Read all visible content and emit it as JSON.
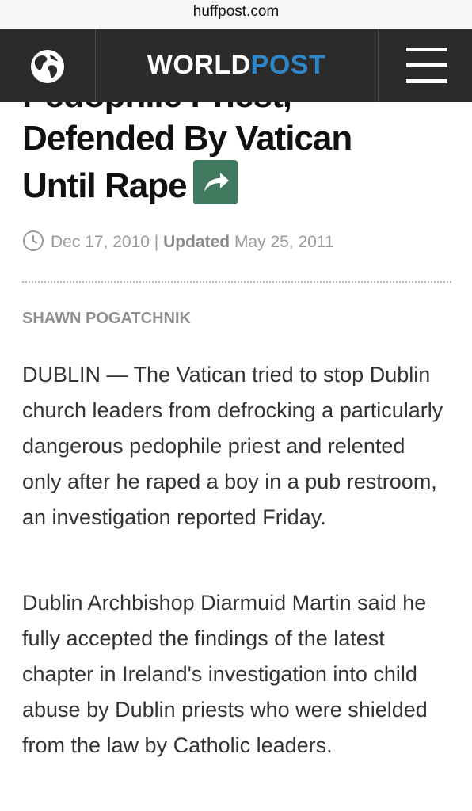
{
  "browser": {
    "url": "huffpost.com"
  },
  "nav": {
    "brand_world": "WORLD",
    "brand_post": "POST",
    "globe_icon": "globe-icon",
    "menu_icon": "hamburger-menu-icon"
  },
  "article": {
    "headline_cut": "Pedophile Priest,",
    "headline_line2": "Defended By Vatican",
    "headline_line3": "Until Rape",
    "share_icon": "share-arrow-icon",
    "date": "Dec 17, 2010",
    "separator": "|",
    "updated_label": "Updated",
    "updated_date": "May 25, 2011",
    "author": "SHAWN POGATCHNIK",
    "paragraphs": [
      "DUBLIN — The Vatican tried to stop Dublin church leaders from defrocking a particularly dangerous pedophile priest and relented only after he raped a boy in a pub restroom, an investigation reported Friday.",
      "Dublin Archbishop Diarmuid Martin said he fully accepted the findings of the latest chapter in Ireland's investigation into child abuse by Dublin priests who were shielded from the law by Catholic leaders."
    ]
  },
  "colors": {
    "nav_background": "#2b2b2b",
    "brand_post": "#2f86c8",
    "share_button": "#3f7a5e"
  }
}
